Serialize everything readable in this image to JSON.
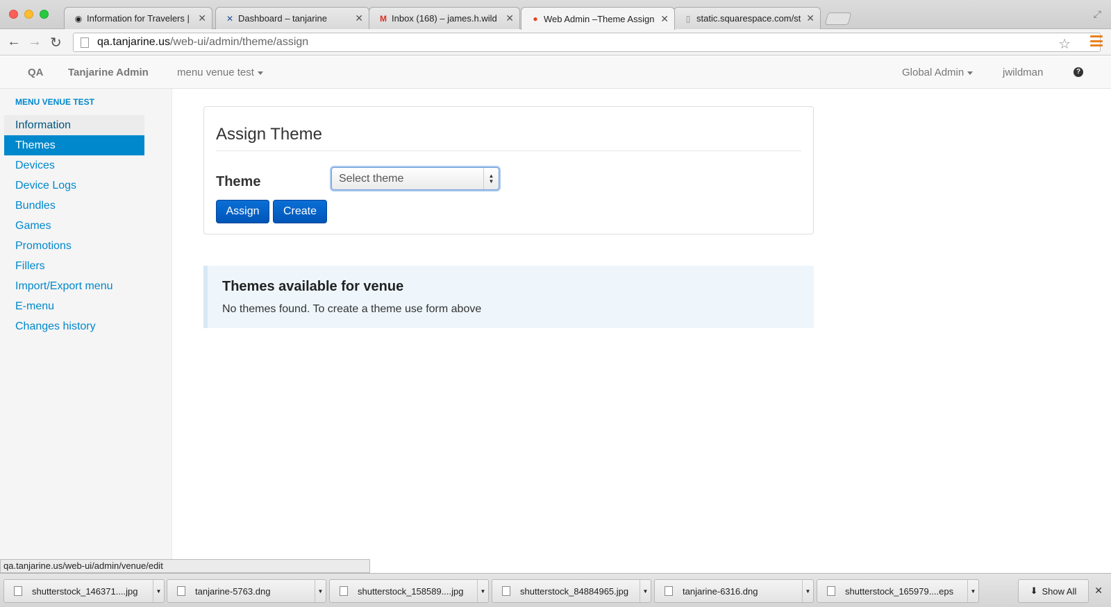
{
  "browser": {
    "tabs": [
      {
        "title": "Information for Travelers |",
        "favicon": "seal-icon"
      },
      {
        "title": "Dashboard – tanjarine",
        "favicon": "x-logo-icon"
      },
      {
        "title": "Inbox (168) – james.h.wild",
        "favicon": "gmail-icon"
      },
      {
        "title": "Web Admin –Theme Assign",
        "favicon": "apple-icon"
      },
      {
        "title": "static.squarespace.com/st",
        "favicon": "page-icon"
      }
    ],
    "active_tab": 3,
    "url": {
      "host": "qa.tanjarine.us",
      "path": "/web-ui/admin/theme/assign"
    },
    "status_url": "qa.tanjarine.us/web-ui/admin/venue/edit"
  },
  "header": {
    "env": "QA",
    "brand": "Tanjarine Admin",
    "venue_menu": "menu venue test",
    "role_menu": "Global Admin",
    "user": "jwildman",
    "help_glyph": "?"
  },
  "sidebar": {
    "heading": "MENU VENUE TEST",
    "items": [
      {
        "label": "Information"
      },
      {
        "label": "Themes"
      },
      {
        "label": "Devices"
      },
      {
        "label": "Device Logs"
      },
      {
        "label": "Bundles"
      },
      {
        "label": "Games"
      },
      {
        "label": "Promotions"
      },
      {
        "label": "Fillers"
      },
      {
        "label": "Import/Export menu"
      },
      {
        "label": "E-menu"
      },
      {
        "label": "Changes history"
      }
    ],
    "active_index": 1,
    "hover_index": 0
  },
  "assign": {
    "title": "Assign Theme",
    "field_label": "Theme",
    "select_value": "Select theme",
    "assign_label": "Assign",
    "create_label": "Create"
  },
  "available": {
    "title": "Themes available for venue",
    "message": "No themes found. To create a theme use form above"
  },
  "downloads": {
    "items": [
      {
        "name": "shutterstock_146371....jpg"
      },
      {
        "name": "tanjarine-5763.dng"
      },
      {
        "name": "shutterstock_158589....jpg"
      },
      {
        "name": "shutterstock_84884965.jpg"
      },
      {
        "name": "tanjarine-6316.dng"
      },
      {
        "name": "shutterstock_165979....eps"
      }
    ],
    "show_all_label": "Show All"
  },
  "colors": {
    "link": "#0088cc",
    "button": "#0a6fd6",
    "alert_bg": "#eef6fc"
  }
}
